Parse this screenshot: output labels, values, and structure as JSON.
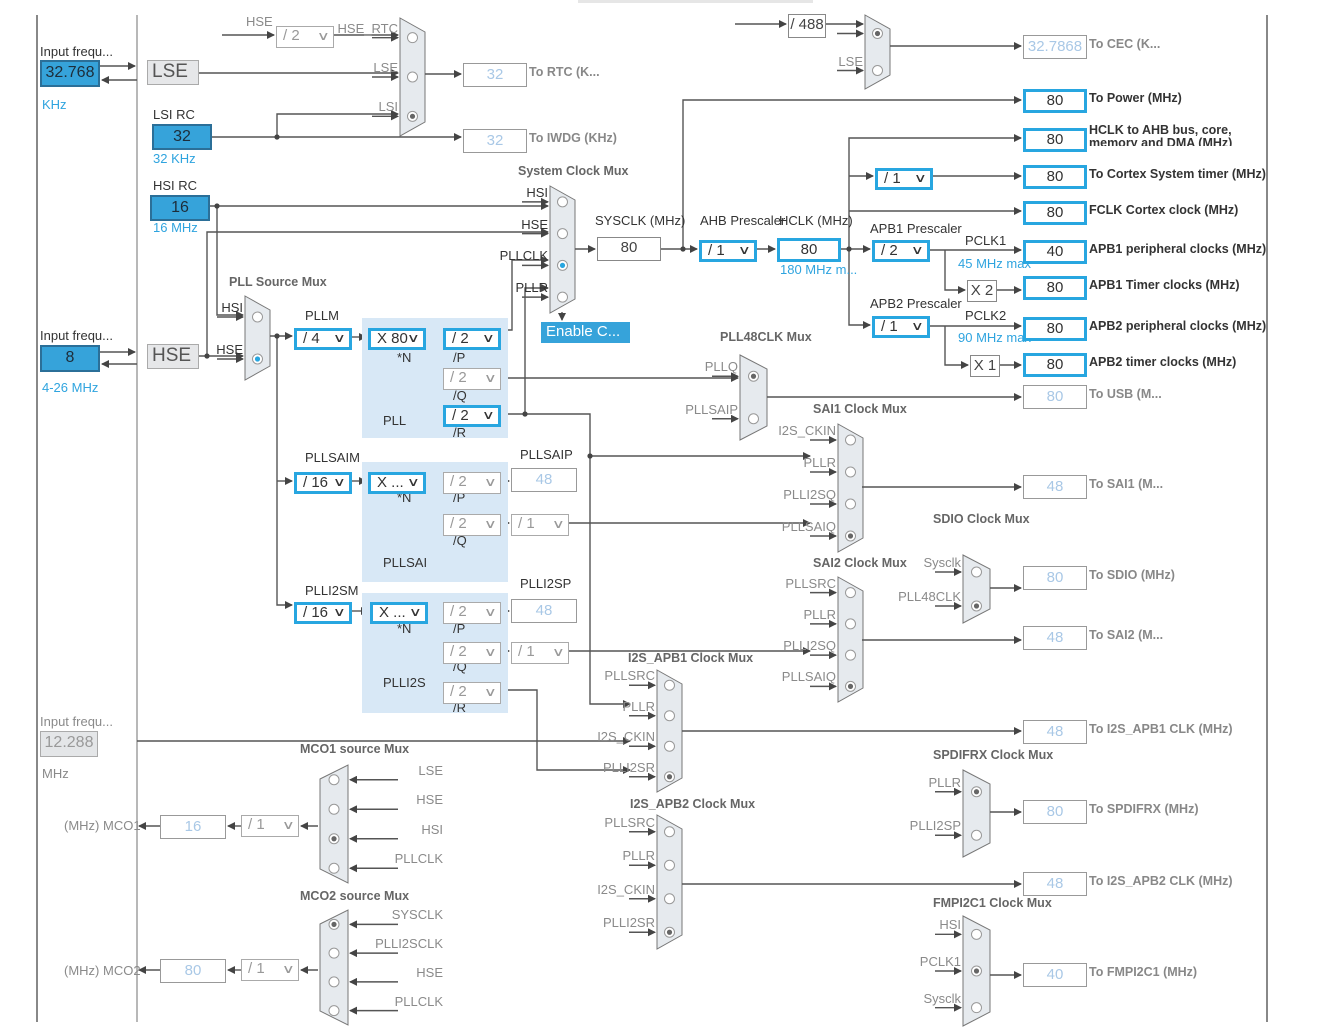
{
  "colors": {
    "accent": "#28a6e0",
    "source_fill": "#36a3da",
    "pll_region": "#d8e8f6",
    "disabled_text": "#a9c8e6"
  },
  "sources": {
    "lse_freq": "32.768",
    "lse_unit": "KHz",
    "lse_input_label": "Input frequ...",
    "lse_name": "LSE",
    "lsi_name": "LSI RC",
    "lsi_value": "32",
    "lsi_range": "32 KHz",
    "hsi_name": "HSI RC",
    "hsi_value": "16",
    "hsi_range": "16 MHz",
    "hse_input_label": "Input frequ...",
    "hse_freq": "8",
    "hse_range": "4-26 MHz",
    "hse_name": "HSE",
    "i2s_input_label": "Input frequ...",
    "i2s_freq": "12.288",
    "i2s_unit": "MHz"
  },
  "labels": {
    "rtc_hse": "HSE",
    "sysclk": "SYSCLK (MHz)",
    "ahb_prescaler": "AHB Prescaler",
    "hclk": "HCLK (MHz)",
    "hclk_max": "180 MHz m...",
    "apb1_prescaler": "APB1 Prescaler",
    "pclk1": "PCLK1",
    "pclk1_max": "45 MHz max",
    "apb2_prescaler": "APB2 Prescaler",
    "pclk2": "PCLK2",
    "pclk2_max": "90 MHz max",
    "pllm": "PLLM",
    "pll_n": "*N",
    "pll_p": "/P",
    "pll_q": "/Q",
    "pll_r": "/R",
    "pll": "PLL",
    "pllsaim": "PLLSAIM",
    "pllsaip": "PLLSAIP",
    "pllsai_n": "*N",
    "pllsai_p": "/P",
    "pllsai_q": "/Q",
    "pllsai": "PLLSAI",
    "plli2sm": "PLLI2SM",
    "plli2sp": "PLLI2SP",
    "plli2s_n": "*N",
    "plli2s_p": "/P",
    "plli2s_q": "/Q",
    "plli2s_r": "/R",
    "plli2s": "PLLI2S",
    "mco1": "(MHz) MCO1",
    "mco2": "(MHz) MCO2"
  },
  "selects": {
    "rtc_hse_div": "/ 2",
    "cec_div": "/ 488",
    "pllm": "/ 4",
    "plln": "X 80",
    "pllp": "/ 2",
    "pllq": "/ 2",
    "pllr": "/ 2",
    "ahb": "/ 1",
    "cortex_div": "/ 1",
    "apb1": "/ 2",
    "apb2": "/ 1",
    "apb1_timer_mult": "X 2",
    "apb2_timer_mult": "X 1",
    "pllsaim": "/ 16",
    "pllsain": "X ...",
    "pllsaip": "/ 2",
    "pllsaiq": "/ 2",
    "pllsaiq_div": "/ 1",
    "plli2sm": "/ 16",
    "plli2sn": "X ...",
    "plli2sp": "/ 2",
    "plli2sq": "/ 2",
    "plli2sq_div": "/ 1",
    "plli2sr": "/ 2",
    "mco1_div": "/ 1",
    "mco2_div": "/ 1"
  },
  "values": {
    "sysclk": "80",
    "hclk": "80",
    "pllsaip_out": "48",
    "plli2sp_out": "48",
    "mco1": "16",
    "mco2": "80"
  },
  "buttons": {
    "enable_css": "Enable C..."
  },
  "outputs": [
    {
      "value": "32",
      "label": "To RTC (K...",
      "enabled": false
    },
    {
      "value": "32",
      "label": "To IWDG (KHz)",
      "enabled": false
    },
    {
      "value": "32.7868",
      "label": "To CEC (K...",
      "enabled": false
    },
    {
      "value": "80",
      "label": "To Power (MHz)",
      "enabled": true
    },
    {
      "value": "80",
      "label": "HCLK to AHB bus, core, memory and DMA (MHz)",
      "enabled": true
    },
    {
      "value": "80",
      "label": "To Cortex System timer (MHz)",
      "enabled": true
    },
    {
      "value": "80",
      "label": "FCLK Cortex clock (MHz)",
      "enabled": true
    },
    {
      "value": "40",
      "label": "APB1 peripheral clocks (MHz)",
      "enabled": true
    },
    {
      "value": "80",
      "label": "APB1 Timer clocks (MHz)",
      "enabled": true
    },
    {
      "value": "80",
      "label": "APB2 peripheral clocks (MHz)",
      "enabled": true
    },
    {
      "value": "80",
      "label": "APB2 timer clocks (MHz)",
      "enabled": true
    },
    {
      "value": "80",
      "label": "To USB (M...",
      "enabled": false
    },
    {
      "value": "48",
      "label": "To SAI1 (M...",
      "enabled": false
    },
    {
      "value": "80",
      "label": "To SDIO (MHz)",
      "enabled": false
    },
    {
      "value": "48",
      "label": "To SAI2 (M...",
      "enabled": false
    },
    {
      "value": "48",
      "label": "To I2S_APB1 CLK (MHz)",
      "enabled": false
    },
    {
      "value": "80",
      "label": "To SPDIFRX (MHz)",
      "enabled": false
    },
    {
      "value": "48",
      "label": "To I2S_APB2 CLK (MHz)",
      "enabled": false
    },
    {
      "value": "40",
      "label": "To FMPI2C1 (MHz)",
      "enabled": false
    }
  ],
  "muxes": {
    "rtc": {
      "title": "",
      "inputs": [
        "HSE_RTC",
        "LSE",
        "LSI"
      ],
      "selected": 2
    },
    "cec": {
      "title": "",
      "inputs": [
        "",
        "LSE"
      ],
      "selected": 0
    },
    "sys": {
      "title": "System Clock Mux",
      "inputs": [
        "HSI",
        "HSE",
        "PLLCLK",
        "PLLR"
      ],
      "selected": 2
    },
    "pllsrc": {
      "title": "PLL Source Mux",
      "inputs": [
        "HSI",
        "HSE"
      ],
      "selected": 1
    },
    "pll48": {
      "title": "PLL48CLK Mux",
      "inputs": [
        "PLLQ",
        "PLLSAIP"
      ],
      "selected": 0
    },
    "sai1": {
      "title": "SAI1 Clock Mux",
      "inputs": [
        "I2S_CKIN",
        "PLLR",
        "PLLI2SQ",
        "PLLSAIQ"
      ],
      "selected": 3
    },
    "sdio": {
      "title": "SDIO Clock Mux",
      "inputs": [
        "Sysclk",
        "PLL48CLK"
      ],
      "selected": 1
    },
    "sai2": {
      "title": "SAI2 Clock Mux",
      "inputs": [
        "PLLSRC",
        "PLLR",
        "PLLI2SQ",
        "PLLSAIQ"
      ],
      "selected": 3
    },
    "i2s_apb1": {
      "title": "I2S_APB1 Clock Mux",
      "inputs": [
        "PLLSRC",
        "PLLR",
        "I2S_CKIN",
        "PLLI2SR"
      ],
      "selected": 3
    },
    "spdifrx": {
      "title": "SPDIFRX Clock Mux",
      "inputs": [
        "PLLR",
        "PLLI2SP"
      ],
      "selected": 0
    },
    "i2s_apb2": {
      "title": "I2S_APB2 Clock Mux",
      "inputs": [
        "PLLSRC",
        "PLLR",
        "I2S_CKIN",
        "PLLI2SR"
      ],
      "selected": 3
    },
    "fmpi2c1": {
      "title": "FMPI2C1 Clock Mux",
      "inputs": [
        "HSI",
        "PCLK1",
        "Sysclk"
      ],
      "selected": 1
    },
    "mco1": {
      "title": "MCO1 source Mux",
      "inputs": [
        "LSE",
        "HSE",
        "HSI",
        "PLLCLK"
      ],
      "selected": 2
    },
    "mco2": {
      "title": "MCO2 source Mux",
      "inputs": [
        "SYSCLK",
        "PLLI2SCLK",
        "HSE",
        "PLLCLK"
      ],
      "selected": 0
    }
  }
}
